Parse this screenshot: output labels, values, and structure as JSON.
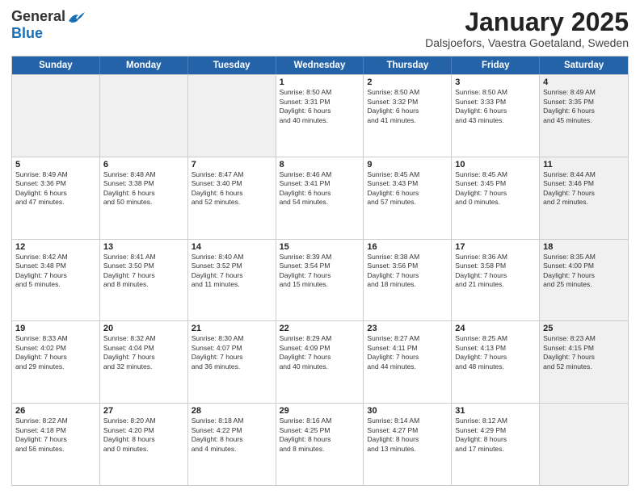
{
  "header": {
    "logo_general": "General",
    "logo_blue": "Blue",
    "cal_title": "January 2025",
    "cal_subtitle": "Dalsjoefors, Vaestra Goetaland, Sweden"
  },
  "days_of_week": [
    "Sunday",
    "Monday",
    "Tuesday",
    "Wednesday",
    "Thursday",
    "Friday",
    "Saturday"
  ],
  "weeks": [
    [
      {
        "day": "",
        "info": "",
        "shaded": true
      },
      {
        "day": "",
        "info": "",
        "shaded": true
      },
      {
        "day": "",
        "info": "",
        "shaded": true
      },
      {
        "day": "1",
        "info": "Sunrise: 8:50 AM\nSunset: 3:31 PM\nDaylight: 6 hours\nand 40 minutes.",
        "shaded": false
      },
      {
        "day": "2",
        "info": "Sunrise: 8:50 AM\nSunset: 3:32 PM\nDaylight: 6 hours\nand 41 minutes.",
        "shaded": false
      },
      {
        "day": "3",
        "info": "Sunrise: 8:50 AM\nSunset: 3:33 PM\nDaylight: 6 hours\nand 43 minutes.",
        "shaded": false
      },
      {
        "day": "4",
        "info": "Sunrise: 8:49 AM\nSunset: 3:35 PM\nDaylight: 6 hours\nand 45 minutes.",
        "shaded": true
      }
    ],
    [
      {
        "day": "5",
        "info": "Sunrise: 8:49 AM\nSunset: 3:36 PM\nDaylight: 6 hours\nand 47 minutes.",
        "shaded": false
      },
      {
        "day": "6",
        "info": "Sunrise: 8:48 AM\nSunset: 3:38 PM\nDaylight: 6 hours\nand 50 minutes.",
        "shaded": false
      },
      {
        "day": "7",
        "info": "Sunrise: 8:47 AM\nSunset: 3:40 PM\nDaylight: 6 hours\nand 52 minutes.",
        "shaded": false
      },
      {
        "day": "8",
        "info": "Sunrise: 8:46 AM\nSunset: 3:41 PM\nDaylight: 6 hours\nand 54 minutes.",
        "shaded": false
      },
      {
        "day": "9",
        "info": "Sunrise: 8:45 AM\nSunset: 3:43 PM\nDaylight: 6 hours\nand 57 minutes.",
        "shaded": false
      },
      {
        "day": "10",
        "info": "Sunrise: 8:45 AM\nSunset: 3:45 PM\nDaylight: 7 hours\nand 0 minutes.",
        "shaded": false
      },
      {
        "day": "11",
        "info": "Sunrise: 8:44 AM\nSunset: 3:46 PM\nDaylight: 7 hours\nand 2 minutes.",
        "shaded": true
      }
    ],
    [
      {
        "day": "12",
        "info": "Sunrise: 8:42 AM\nSunset: 3:48 PM\nDaylight: 7 hours\nand 5 minutes.",
        "shaded": false
      },
      {
        "day": "13",
        "info": "Sunrise: 8:41 AM\nSunset: 3:50 PM\nDaylight: 7 hours\nand 8 minutes.",
        "shaded": false
      },
      {
        "day": "14",
        "info": "Sunrise: 8:40 AM\nSunset: 3:52 PM\nDaylight: 7 hours\nand 11 minutes.",
        "shaded": false
      },
      {
        "day": "15",
        "info": "Sunrise: 8:39 AM\nSunset: 3:54 PM\nDaylight: 7 hours\nand 15 minutes.",
        "shaded": false
      },
      {
        "day": "16",
        "info": "Sunrise: 8:38 AM\nSunset: 3:56 PM\nDaylight: 7 hours\nand 18 minutes.",
        "shaded": false
      },
      {
        "day": "17",
        "info": "Sunrise: 8:36 AM\nSunset: 3:58 PM\nDaylight: 7 hours\nand 21 minutes.",
        "shaded": false
      },
      {
        "day": "18",
        "info": "Sunrise: 8:35 AM\nSunset: 4:00 PM\nDaylight: 7 hours\nand 25 minutes.",
        "shaded": true
      }
    ],
    [
      {
        "day": "19",
        "info": "Sunrise: 8:33 AM\nSunset: 4:02 PM\nDaylight: 7 hours\nand 29 minutes.",
        "shaded": false
      },
      {
        "day": "20",
        "info": "Sunrise: 8:32 AM\nSunset: 4:04 PM\nDaylight: 7 hours\nand 32 minutes.",
        "shaded": false
      },
      {
        "day": "21",
        "info": "Sunrise: 8:30 AM\nSunset: 4:07 PM\nDaylight: 7 hours\nand 36 minutes.",
        "shaded": false
      },
      {
        "day": "22",
        "info": "Sunrise: 8:29 AM\nSunset: 4:09 PM\nDaylight: 7 hours\nand 40 minutes.",
        "shaded": false
      },
      {
        "day": "23",
        "info": "Sunrise: 8:27 AM\nSunset: 4:11 PM\nDaylight: 7 hours\nand 44 minutes.",
        "shaded": false
      },
      {
        "day": "24",
        "info": "Sunrise: 8:25 AM\nSunset: 4:13 PM\nDaylight: 7 hours\nand 48 minutes.",
        "shaded": false
      },
      {
        "day": "25",
        "info": "Sunrise: 8:23 AM\nSunset: 4:15 PM\nDaylight: 7 hours\nand 52 minutes.",
        "shaded": true
      }
    ],
    [
      {
        "day": "26",
        "info": "Sunrise: 8:22 AM\nSunset: 4:18 PM\nDaylight: 7 hours\nand 56 minutes.",
        "shaded": false
      },
      {
        "day": "27",
        "info": "Sunrise: 8:20 AM\nSunset: 4:20 PM\nDaylight: 8 hours\nand 0 minutes.",
        "shaded": false
      },
      {
        "day": "28",
        "info": "Sunrise: 8:18 AM\nSunset: 4:22 PM\nDaylight: 8 hours\nand 4 minutes.",
        "shaded": false
      },
      {
        "day": "29",
        "info": "Sunrise: 8:16 AM\nSunset: 4:25 PM\nDaylight: 8 hours\nand 8 minutes.",
        "shaded": false
      },
      {
        "day": "30",
        "info": "Sunrise: 8:14 AM\nSunset: 4:27 PM\nDaylight: 8 hours\nand 13 minutes.",
        "shaded": false
      },
      {
        "day": "31",
        "info": "Sunrise: 8:12 AM\nSunset: 4:29 PM\nDaylight: 8 hours\nand 17 minutes.",
        "shaded": false
      },
      {
        "day": "",
        "info": "",
        "shaded": true
      }
    ]
  ]
}
